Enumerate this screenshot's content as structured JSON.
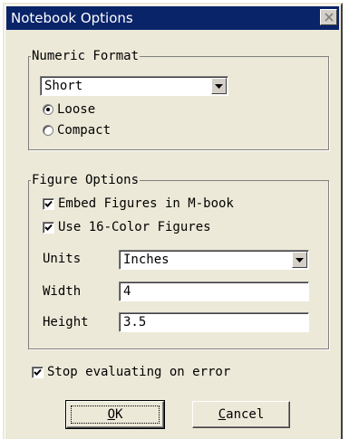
{
  "window": {
    "title": "Notebook Options"
  },
  "numeric_format": {
    "group_label": "Numeric Format",
    "format_value": "Short",
    "spacing_options": [
      {
        "label": "Loose",
        "selected": true
      },
      {
        "label": "Compact",
        "selected": false
      }
    ]
  },
  "figure_options": {
    "group_label": "Figure Options",
    "embed_figures": {
      "label": "Embed Figures in M-book",
      "checked": true
    },
    "use_16_color": {
      "label": "Use 16-Color Figures",
      "checked": true
    },
    "units": {
      "label": "Units",
      "value": "Inches"
    },
    "width": {
      "label": "Width",
      "value": "4"
    },
    "height": {
      "label": "Height",
      "value": "3.5"
    }
  },
  "stop_on_error": {
    "label": "Stop evaluating on error",
    "checked": true
  },
  "buttons": {
    "ok": {
      "mnemonic": "O",
      "rest": "K"
    },
    "cancel": {
      "mnemonic": "C",
      "rest": "ancel"
    }
  },
  "icons": {
    "close": "close-icon",
    "dropdown": "chevron-down-icon",
    "check": "checkmark-icon"
  }
}
